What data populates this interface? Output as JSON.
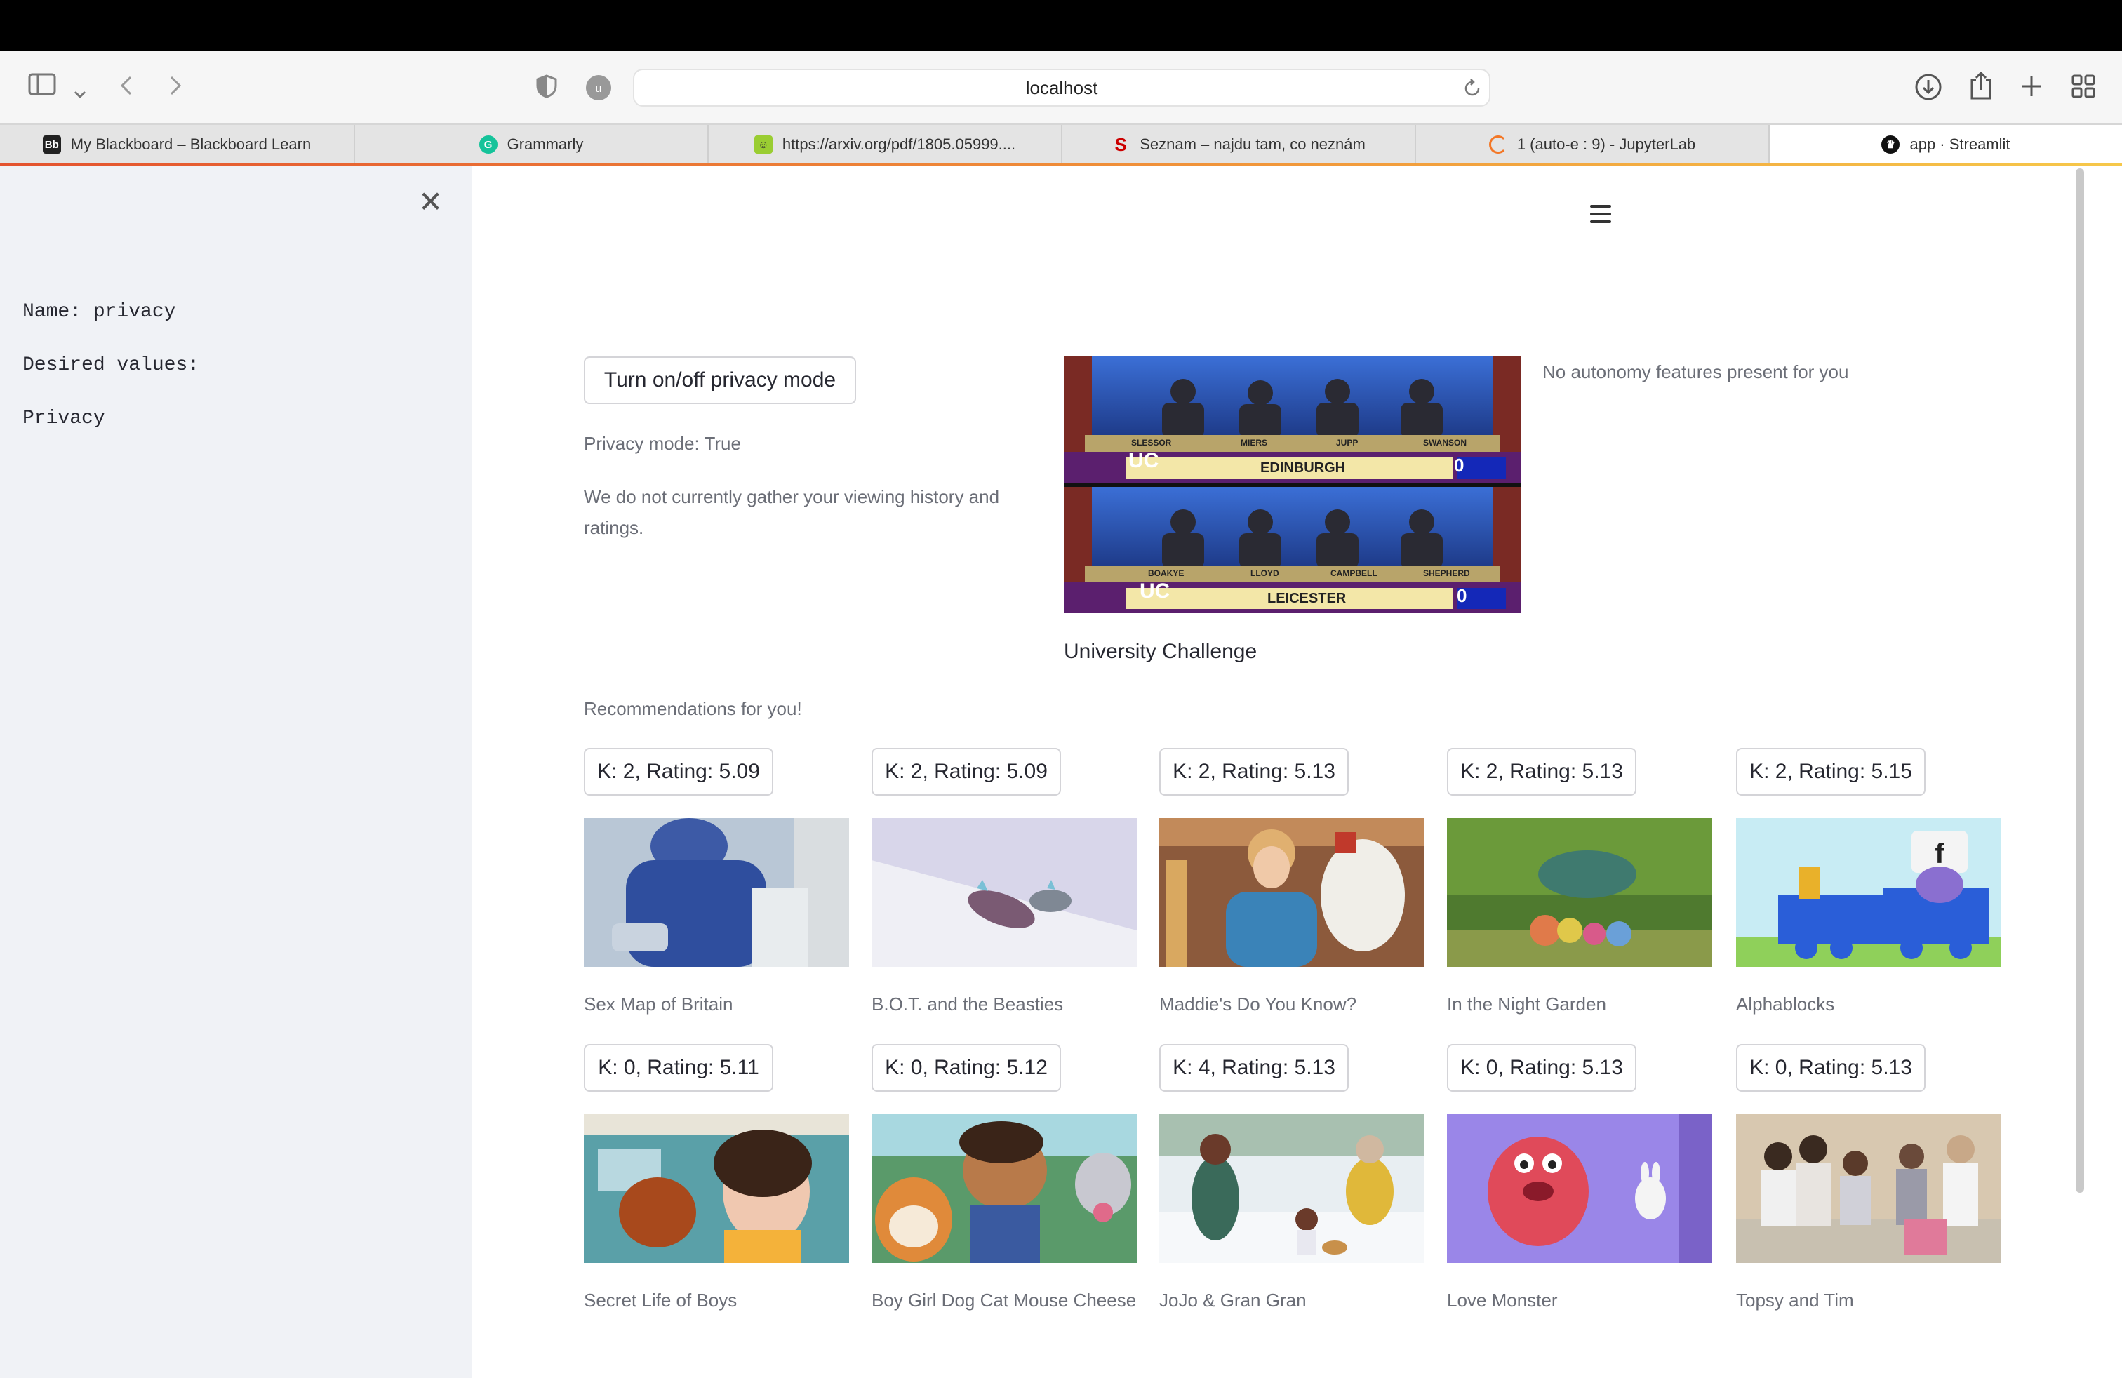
{
  "browser": {
    "address": "localhost",
    "tabs": [
      {
        "label": "My Blackboard – Blackboard Learn",
        "icon": "blackboard-icon"
      },
      {
        "label": "Grammarly",
        "icon": "grammarly-icon"
      },
      {
        "label": "https://arxiv.org/pdf/1805.05999....",
        "icon": "arxiv-icon"
      },
      {
        "label": "Seznam – najdu tam, co neznám",
        "icon": "seznam-icon"
      },
      {
        "label": "1 (auto-e : 9) - JupyterLab",
        "icon": "jupyter-icon"
      },
      {
        "label": "app · Streamlit",
        "icon": "streamlit-icon"
      }
    ]
  },
  "sidebar": {
    "name_line": "Name: privacy",
    "desired_label": "Desired values:",
    "value": "Privacy"
  },
  "main": {
    "privacy_button": "Turn on/off privacy mode",
    "privacy_status": "Privacy mode: True",
    "privacy_note": "We do not currently gather your viewing history and ratings.",
    "featured_title": "University Challenge",
    "autonomy_note": "No autonomy features present for you",
    "featured_image": {
      "top": {
        "team": "EDINBURGH",
        "names": [
          "SLESSOR",
          "MIERS",
          "JUPP",
          "SWANSON"
        ],
        "score": "0"
      },
      "bottom": {
        "team": "LEICESTER",
        "names": [
          "BOAKYE",
          "LLOYD",
          "CAMPBELL",
          "SHEPHERD"
        ],
        "score": "0"
      },
      "logo": "UC"
    },
    "recommendations_label": "Recommendations for you!",
    "recommendations": [
      {
        "button": "K: 2, Rating: 5.09",
        "title": "Sex Map of Britain"
      },
      {
        "button": "K: 2, Rating: 5.09",
        "title": "B.O.T. and the Beasties"
      },
      {
        "button": "K: 2, Rating: 5.13",
        "title": "Maddie's Do You Know?"
      },
      {
        "button": "K: 2, Rating: 5.13",
        "title": "In the Night Garden"
      },
      {
        "button": "K: 2, Rating: 5.15",
        "title": "Alphablocks"
      },
      {
        "button": "K: 0, Rating: 5.11",
        "title": "Secret Life of Boys"
      },
      {
        "button": "K: 0, Rating: 5.12",
        "title": "Boy Girl Dog Cat Mouse Cheese"
      },
      {
        "button": "K: 4, Rating: 5.13",
        "title": "JoJo & Gran Gran"
      },
      {
        "button": "K: 0, Rating: 5.13",
        "title": "Love Monster"
      },
      {
        "button": "K: 0, Rating: 5.13",
        "title": "Topsy and Tim"
      }
    ]
  }
}
